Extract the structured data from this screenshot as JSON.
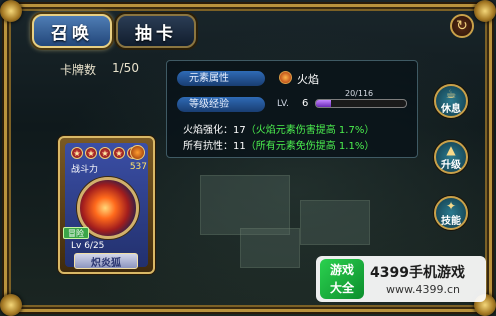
{
  "tabs": [
    {
      "label": "召唤",
      "active": true
    },
    {
      "label": "抽卡",
      "active": false
    }
  ],
  "card_count": {
    "label": "卡牌数",
    "value": "1/50"
  },
  "card": {
    "stars": 5,
    "power_label": "战斗力",
    "power_value": "537",
    "badge": "冒险",
    "level": "Lv 6/25",
    "name": "炽炎狐"
  },
  "info": {
    "element_label": "元素属性",
    "element_value": "火焰",
    "level_label": "等级经验",
    "level_prefix": "LV.",
    "level_value": "6",
    "xp_text": "20/116",
    "xp_fraction": 0.172,
    "stat1_label": "火焰强化：17",
    "stat1_detail": "（火焰元素伤害提高 1.7%）",
    "stat2_label": "所有抗性：11",
    "stat2_detail": "（所有元素免伤提高 1.1%）"
  },
  "side_buttons": [
    {
      "label": "休息",
      "icon": "cup-icon"
    },
    {
      "label": "升级",
      "icon": "arrow-up-icon"
    },
    {
      "label": "技能",
      "icon": "skill-icon"
    }
  ],
  "watermark": {
    "logo_top": "游戏",
    "logo_bottom": "大全",
    "title": "4399手机游戏",
    "url": "www.4399.cn"
  },
  "colors": {
    "accent_gold": "#c9a14a",
    "xp_purple": "#a25ce8",
    "stat_green": "#4cf04f"
  }
}
